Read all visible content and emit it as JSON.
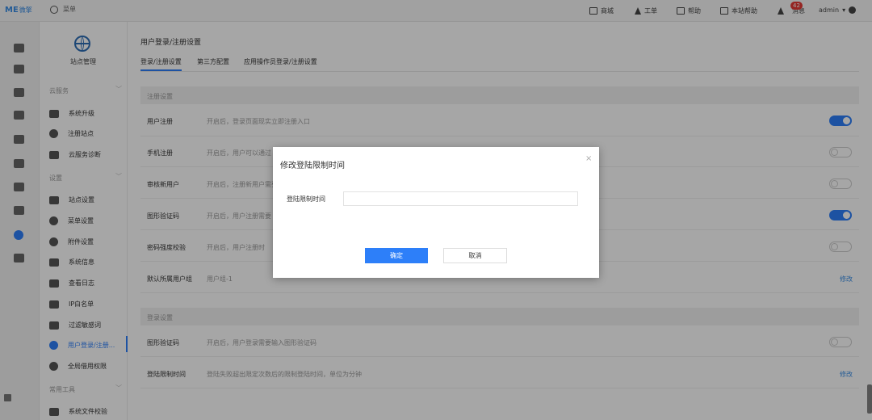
{
  "topbar": {
    "logo": "ME",
    "logo_sub": "微擎",
    "menu_label": "菜单",
    "items": [
      {
        "label": "商城",
        "icon": "shop-icon"
      },
      {
        "label": "工单",
        "icon": "bell-icon"
      },
      {
        "label": "帮助",
        "icon": "help-icon"
      },
      {
        "label": "本站帮助",
        "icon": "site-help-icon"
      },
      {
        "label": "消息",
        "icon": "bell-icon"
      }
    ],
    "message_badge": "42",
    "user": "admin"
  },
  "sidebar": {
    "site_label": "站点管理",
    "sections": [
      {
        "title": "云服务",
        "items": [
          "系统升级",
          "注册站点",
          "云服务诊断"
        ]
      },
      {
        "title": "设置",
        "items": [
          "站点设置",
          "菜单设置",
          "附件设置",
          "系统信息",
          "查看日志",
          "IP白名单",
          "过滤敏感词",
          "用户登录/注册...",
          "全局借用权限"
        ]
      },
      {
        "title": "常用工具",
        "items": [
          "系统文件校验"
        ]
      }
    ]
  },
  "main": {
    "page_title": "用户登录/注册设置",
    "tabs": [
      "登录/注册设置",
      "第三方配置",
      "应用操作员登录/注册设置"
    ],
    "register_section": "注册设置",
    "register_rows": [
      {
        "label": "用户注册",
        "desc": "开启后，登录页面现实立即注册入口",
        "toggle": "on"
      },
      {
        "label": "手机注册",
        "desc": "开启后，用户可以通过",
        "toggle": "off"
      },
      {
        "label": "审核新用户",
        "desc": "开启后，注册新用户需要",
        "toggle": "off"
      },
      {
        "label": "图形验证码",
        "desc": "开启后，用户注册需要",
        "toggle": "on"
      },
      {
        "label": "密码强度校验",
        "desc": "开启后，用户注册时",
        "toggle": "off"
      }
    ],
    "default_group": {
      "label": "默认所属用户组",
      "value": "用户组-1",
      "link": "修改"
    },
    "login_section": "登录设置",
    "login_rows": [
      {
        "label": "图形验证码",
        "desc": "开启后，用户登录需要输入图形验证码",
        "toggle": "off"
      }
    ],
    "login_limit": {
      "label": "登陆限制时间",
      "desc": "登陆失败超出限定次数后的限制登陆时间，单位为分钟",
      "link": "修改"
    }
  },
  "modal": {
    "title": "修改登陆限制时间",
    "close": "×",
    "field_label": "登陆限制时间",
    "field_value": "",
    "ok_label": "确定",
    "cancel_label": "取消"
  }
}
